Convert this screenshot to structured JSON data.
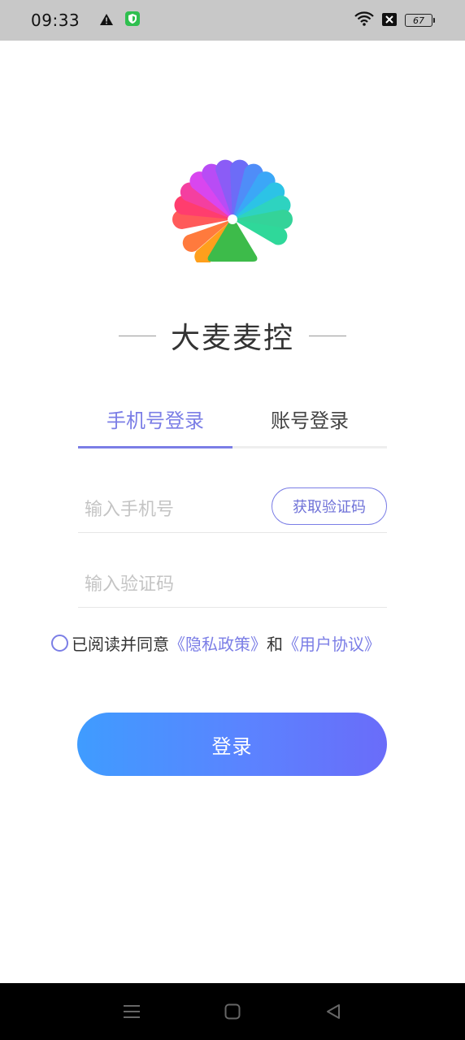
{
  "status_bar": {
    "time": "09:33",
    "battery": "67",
    "icons": [
      "warning-icon",
      "shield-icon",
      "wifi-icon",
      "sim-off-icon",
      "battery-icon"
    ]
  },
  "app": {
    "title": "大麦麦控"
  },
  "tabs": [
    {
      "label": "手机号登录",
      "active": true
    },
    {
      "label": "账号登录",
      "active": false
    }
  ],
  "form": {
    "phone_placeholder": "输入手机号",
    "phone_value": "",
    "code_placeholder": "输入验证码",
    "code_value": "",
    "get_code_label": "获取验证码"
  },
  "agreement": {
    "prefix": "已阅读并同意",
    "privacy_link": "《隐私政策》",
    "and": "和",
    "terms_link": "《用户协议》",
    "checked": false
  },
  "login": {
    "label": "登录"
  },
  "colors": {
    "accent": "#7b7ee6",
    "button_gradient_start": "#3f9cff",
    "button_gradient_end": "#6a6cf9",
    "status_bar": "#c8c8c8"
  },
  "nav_bar": {
    "icons": [
      "menu-icon",
      "home-icon",
      "back-icon"
    ]
  }
}
